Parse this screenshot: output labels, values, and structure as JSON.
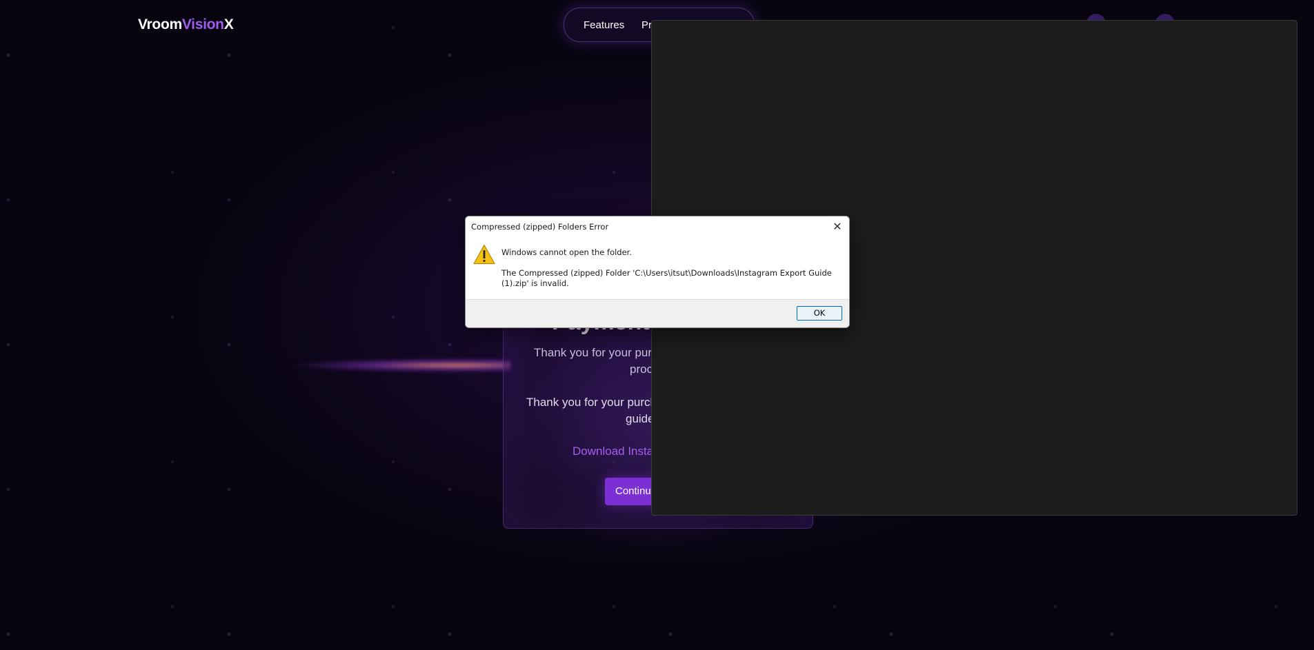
{
  "header": {
    "logo_part1": "Vroom",
    "logo_part2": "Vision",
    "logo_part3": "X",
    "nav": {
      "features": "Features",
      "pricing_partial": "Pr"
    }
  },
  "card": {
    "title_partial": "Payment",
    "text1_line1": "Thank you for your purc",
    "text1_line2": "proc",
    "text2_line1": "Thank you for your purcha",
    "text2_line2": "guide",
    "link_partial": "Download Instag",
    "continue_partial": "Continue"
  },
  "dialog": {
    "title": "Compressed (zipped) Folders Error",
    "message": "Windows cannot open the folder.",
    "detail": "The Compressed (zipped) Folder 'C:\\Users\\itsut\\Downloads\\Instagram Export Guide (1).zip' is invalid.",
    "ok_label": "OK",
    "close_glyph": "✕"
  },
  "colors": {
    "accent": "#a25cf0",
    "button": "#7d2fd6",
    "overlay": "#1c1c1c",
    "dialog_ok_border": "#0067c0"
  },
  "icons": {
    "warning": "warning-icon",
    "close": "close-icon"
  }
}
